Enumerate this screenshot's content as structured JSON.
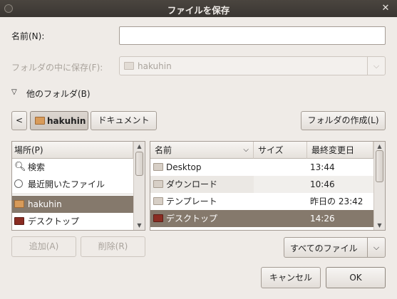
{
  "window": {
    "title": "ファイルを保存"
  },
  "name_field": {
    "label": "名前(N):",
    "value": ""
  },
  "save_in": {
    "label": "フォルダの中に保存(F):",
    "value": "hakuhin"
  },
  "other_folders": {
    "label": "他のフォルダ(B)"
  },
  "path_bar": {
    "back": "<",
    "current": "hakuhin",
    "next": "ドキュメント"
  },
  "create_folder": {
    "label": "フォルダの作成(L)"
  },
  "places": {
    "header": "場所(P)",
    "items": [
      {
        "label": "検索",
        "icon": "search-icon"
      },
      {
        "label": "最近開いたファイル",
        "icon": "clock-icon"
      },
      {
        "label": "hakuhin",
        "icon": "home-folder-icon",
        "selected": true
      },
      {
        "label": "デスクトップ",
        "icon": "desktop-icon"
      }
    ],
    "add_label": "追加(A)",
    "remove_label": "削除(R)"
  },
  "files": {
    "columns": {
      "name": "名前",
      "size": "サイズ",
      "modified": "最終変更日"
    },
    "rows": [
      {
        "name": "Desktop",
        "size": "",
        "modified": "13:44",
        "icon": "folder-icon"
      },
      {
        "name": "ダウンロード",
        "size": "",
        "modified": "10:46",
        "icon": "download-folder-icon"
      },
      {
        "name": "テンプレート",
        "size": "",
        "modified": "昨日の 23:42",
        "icon": "templates-folder-icon"
      },
      {
        "name": "デスクトップ",
        "size": "",
        "modified": "14:26",
        "icon": "desktop-folder-icon",
        "selected": true
      }
    ]
  },
  "filter": {
    "value": "すべてのファイル"
  },
  "buttons": {
    "cancel": "キャンセル",
    "ok": "OK"
  }
}
